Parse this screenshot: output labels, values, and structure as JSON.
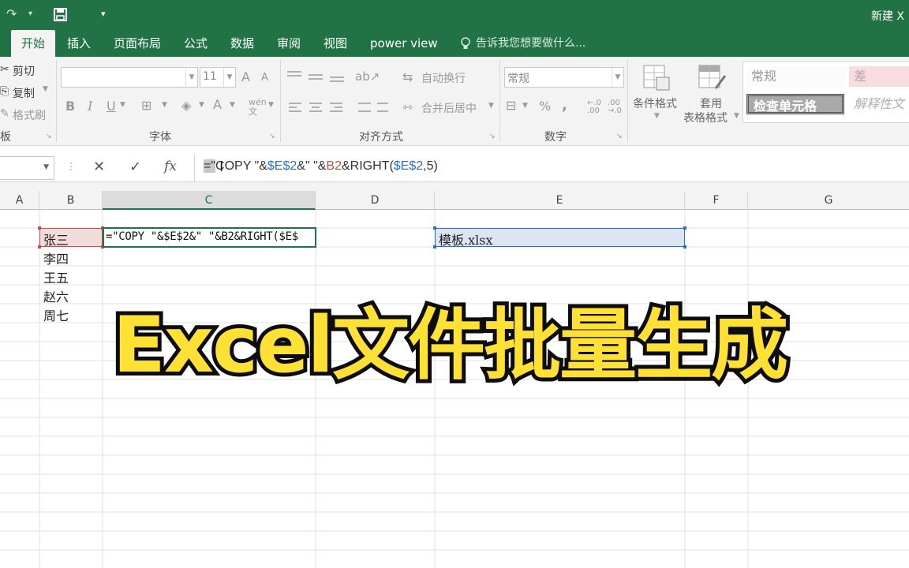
{
  "titlebar": {
    "redo_icon": "redo-arrow",
    "save_icon": "save-disk",
    "customize_icon": "chevron-down",
    "document_title": "新建 X"
  },
  "tabs": [
    "开始",
    "插入",
    "页面布局",
    "公式",
    "数据",
    "审阅",
    "视图",
    "power view"
  ],
  "active_tab": "开始",
  "tell_me": "告诉我您想要做什么...",
  "ribbon": {
    "clipboard": {
      "cut": "剪切",
      "copy": "复制",
      "format_painter": "格式刷",
      "group_label": "板"
    },
    "font": {
      "font_name": "",
      "font_size": "11",
      "grow_font": "A",
      "shrink_font": "A",
      "bold": "B",
      "italic": "I",
      "underline": "U",
      "font_color": "A",
      "phonetic": "wén文",
      "group_label": "字体"
    },
    "alignment": {
      "wrap_text": "自动换行",
      "merge_center": "合并后居中",
      "group_label": "对齐方式"
    },
    "number": {
      "format": "常规",
      "percent": "%",
      "comma": ",",
      "group_label": "数字"
    },
    "styles": {
      "conditional_format": "条件格式",
      "table_format_line1": "套用",
      "table_format_line2": "表格格式",
      "normal": "常规",
      "bad": "差",
      "check_cell": "检查单元格",
      "explanatory": "解释性文"
    }
  },
  "formula_bar": {
    "name_box": "",
    "cancel": "✕",
    "enter": "✓",
    "fx": "fx",
    "formula_parts": [
      {
        "text": "=\"",
        "kind": "plain"
      },
      {
        "text": "COPY \"&",
        "kind": "plain"
      },
      {
        "text": "$E$2",
        "kind": "ref"
      },
      {
        "text": "&\" \"&",
        "kind": "plain"
      },
      {
        "text": "B2",
        "kind": "ref2"
      },
      {
        "text": "&RIGHT(",
        "kind": "plain"
      },
      {
        "text": "$E$2",
        "kind": "ref"
      },
      {
        "text": ",5)",
        "kind": "plain"
      }
    ]
  },
  "columns": [
    "A",
    "B",
    "C",
    "D",
    "E",
    "F",
    "G"
  ],
  "selected_column": "C",
  "cells": {
    "B2": "张三",
    "B3": "李四",
    "B4": "王五",
    "B5": "赵六",
    "B6": "周七",
    "C2": "=\"COPY \"&$E$2&\" \"&B2&RIGHT($E$",
    "E2": "模板.xlsx"
  },
  "overlay_title": "Excel文件批量生成",
  "colors": {
    "excel_green": "#217346",
    "overlay_fill": "#ffe135",
    "overlay_stroke": "#0d0d0d",
    "ref_blue": "#2f6fb8",
    "ref_red": "#c0504d"
  }
}
